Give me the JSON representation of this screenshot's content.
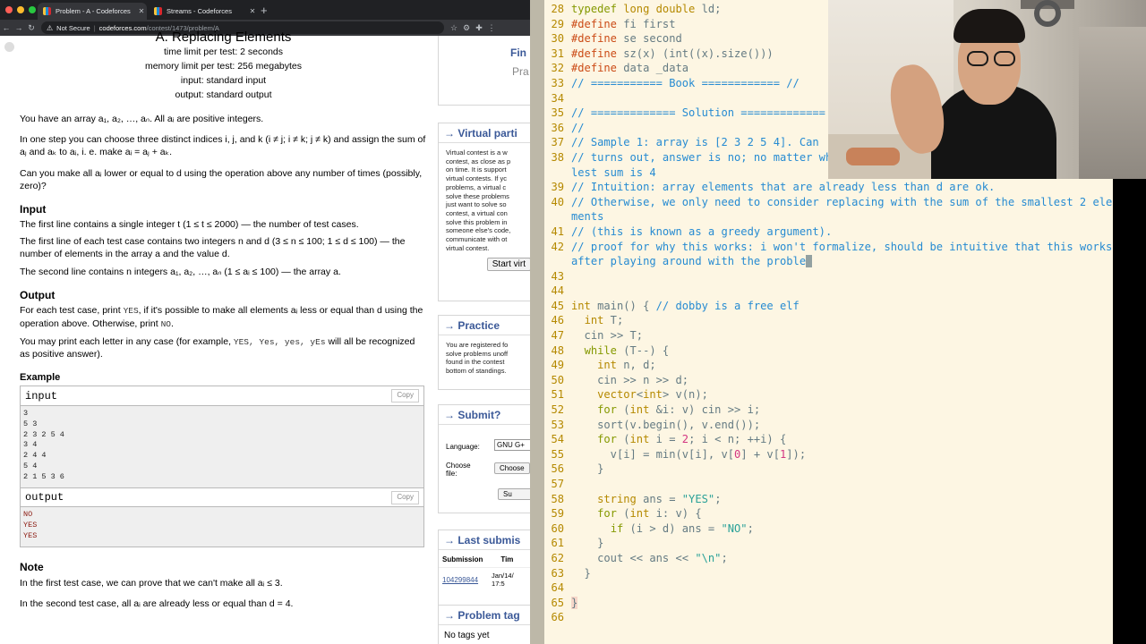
{
  "browser": {
    "tabs": [
      {
        "title": "Problem - A - Codeforces",
        "active": true
      },
      {
        "title": "Streams - Codeforces",
        "active": false
      }
    ],
    "omnibox": {
      "security": "Not Secure",
      "host": "codeforces.com",
      "path": "/contest/1473/problem/A"
    }
  },
  "problem": {
    "title": "A. Replacing Elements",
    "time_limit": "time limit per test: 2 seconds",
    "memory_limit": "memory limit per test: 256 megabytes",
    "input": "input: standard input",
    "output": "output: standard output",
    "p1": "You have an array a₁, a₂, …, aₙ. All aᵢ are positive integers.",
    "p2": "In one step you can choose three distinct indices i, j, and k (i ≠ j; i ≠ k; j ≠ k) and assign the sum of aⱼ and aₖ to aᵢ, i. e. make aᵢ = aⱼ + aₖ.",
    "p3": "Can you make all aᵢ lower or equal to d using the operation above any number of times (possibly, zero)?",
    "input_heading": "Input",
    "in1": "The first line contains a single integer t (1 ≤ t ≤ 2000) — the number of test cases.",
    "in2": "The first line of each test case contains two integers n and d (3 ≤ n ≤ 100; 1 ≤ d ≤ 100) — the number of elements in the array a and the value d.",
    "in3": "The second line contains n integers a₁, a₂, …, aₙ (1 ≤ aᵢ ≤ 100) — the array a.",
    "output_heading": "Output",
    "out1_a": "For each test case, print ",
    "out1_yes": "YES",
    "out1_b": ", if it's possible to make all elements aᵢ less or equal than d using the operation above. Otherwise, print ",
    "out1_no": "NO",
    "out1_c": ".",
    "out2_a": "You may print each letter in any case (for example, ",
    "out2_mono": "YES, Yes, yes, yEs",
    "out2_b": " will all be recognized as positive answer).",
    "example_heading": "Example",
    "input_label": "input",
    "output_label": "output",
    "copy_label": "Copy",
    "example_input": "3\n5 3\n2 3 2 5 4\n3 4\n2 4 4\n5 4\n2 1 5 3 6",
    "example_output": "NO\nYES\nYES",
    "note_heading": "Note",
    "note1": "In the first test case, we can prove that we can't make all aᵢ ≤ 3.",
    "note2": "In the second test case, all aᵢ are already less or equal than d = 4."
  },
  "sidebar": {
    "top_frag": "Fin",
    "top_frag2": "Pra",
    "virtual": {
      "title": "→ Virtual parti",
      "text": [
        "Virtual contest is a w",
        "contest, as close as p",
        "on time. It is support",
        "virtual contests. If yc",
        "problems, a virtual c",
        "solve these problems",
        "just want to solve so",
        "contest, a virtual con",
        "solve this problem in",
        "someone else's code,",
        "communicate with ot",
        "virtual contest."
      ],
      "button": "Start virt"
    },
    "practice": {
      "title": "→ Practice",
      "text": [
        "You are registered fo",
        "solve problems unoff",
        "found in the contest",
        "bottom of standings."
      ]
    },
    "submit": {
      "title": "→ Submit?",
      "language_label": "Language:",
      "language_value": "GNU G+",
      "file_label_1": "Choose",
      "file_label_2": "file:",
      "choose_btn": "Choose",
      "submit_btn": "Su"
    },
    "last": {
      "title": "→ Last submis",
      "col1": "Submission",
      "col2": "Tim",
      "sub_id": "104299844",
      "sub_time_1": "Jan/14/",
      "sub_time_2": "17:5"
    },
    "tags": {
      "title": "→ Problem tag",
      "text": "No tags yet"
    }
  },
  "editor": {
    "lines": [
      {
        "n": "28",
        "t": "typedef long double ld;"
      },
      {
        "n": "29",
        "t": "#define fi first"
      },
      {
        "n": "30",
        "t": "#define se second"
      },
      {
        "n": "31",
        "t": "#define sz(x) (int((x).size()))"
      },
      {
        "n": "32",
        "t": "#define data _data"
      },
      {
        "n": "33",
        "t": "// =========== Book ============ //"
      },
      {
        "n": "34",
        "t": ""
      },
      {
        "n": "35",
        "t": "// ============= Solution ============="
      },
      {
        "n": "36",
        "t": "//"
      },
      {
        "n": "37",
        "t": "// Sample 1: array is [2 3 2 5 4]. Can"
      },
      {
        "n": "38",
        "t": "// turns out, answer is no; no matter what you do, you can't replace them. the smallest sum is 4"
      },
      {
        "n": "39",
        "t": "// Intuition: array elements that are already less than d are ok."
      },
      {
        "n": "40",
        "t": "// Otherwise, we only need to consider replacing with the sum of the smallest 2 elements"
      },
      {
        "n": "41",
        "t": "// (this is known as a greedy argument)."
      },
      {
        "n": "42",
        "t": "// proof for why this works: i won't formalize, should be intuitive that this works after playing around with the proble"
      },
      {
        "n": "43",
        "t": ""
      },
      {
        "n": "44",
        "t": ""
      },
      {
        "n": "45",
        "t": "int main() { // dobby is a free elf"
      },
      {
        "n": "46",
        "t": "  int T;"
      },
      {
        "n": "47",
        "t": "  cin >> T;"
      },
      {
        "n": "48",
        "t": "  while (T--) {"
      },
      {
        "n": "49",
        "t": "    int n, d;"
      },
      {
        "n": "50",
        "t": "    cin >> n >> d;"
      },
      {
        "n": "51",
        "t": "    vector<int> v(n);"
      },
      {
        "n": "52",
        "t": "    for (int &i: v) cin >> i;"
      },
      {
        "n": "53",
        "t": "    sort(v.begin(), v.end());"
      },
      {
        "n": "54",
        "t": "    for (int i = 2; i < n; ++i) {"
      },
      {
        "n": "55",
        "t": "      v[i] = min(v[i], v[0] + v[1]);"
      },
      {
        "n": "56",
        "t": "    }"
      },
      {
        "n": "57",
        "t": ""
      },
      {
        "n": "58",
        "t": "    string ans = \"YES\";"
      },
      {
        "n": "59",
        "t": "    for (int i: v) {"
      },
      {
        "n": "60",
        "t": "      if (i > d) ans = \"NO\";"
      },
      {
        "n": "61",
        "t": "    }"
      },
      {
        "n": "62",
        "t": "    cout << ans << \"\\n\";"
      },
      {
        "n": "63",
        "t": "  }"
      },
      {
        "n": "64",
        "t": ""
      },
      {
        "n": "65",
        "t": "}"
      },
      {
        "n": "66",
        "t": ""
      }
    ]
  },
  "colors": {
    "accent": "#3b5998",
    "editor_bg": "#fdf6e3",
    "comment": "#268bd2",
    "keyword": "#859900",
    "string": "#2aa198"
  }
}
